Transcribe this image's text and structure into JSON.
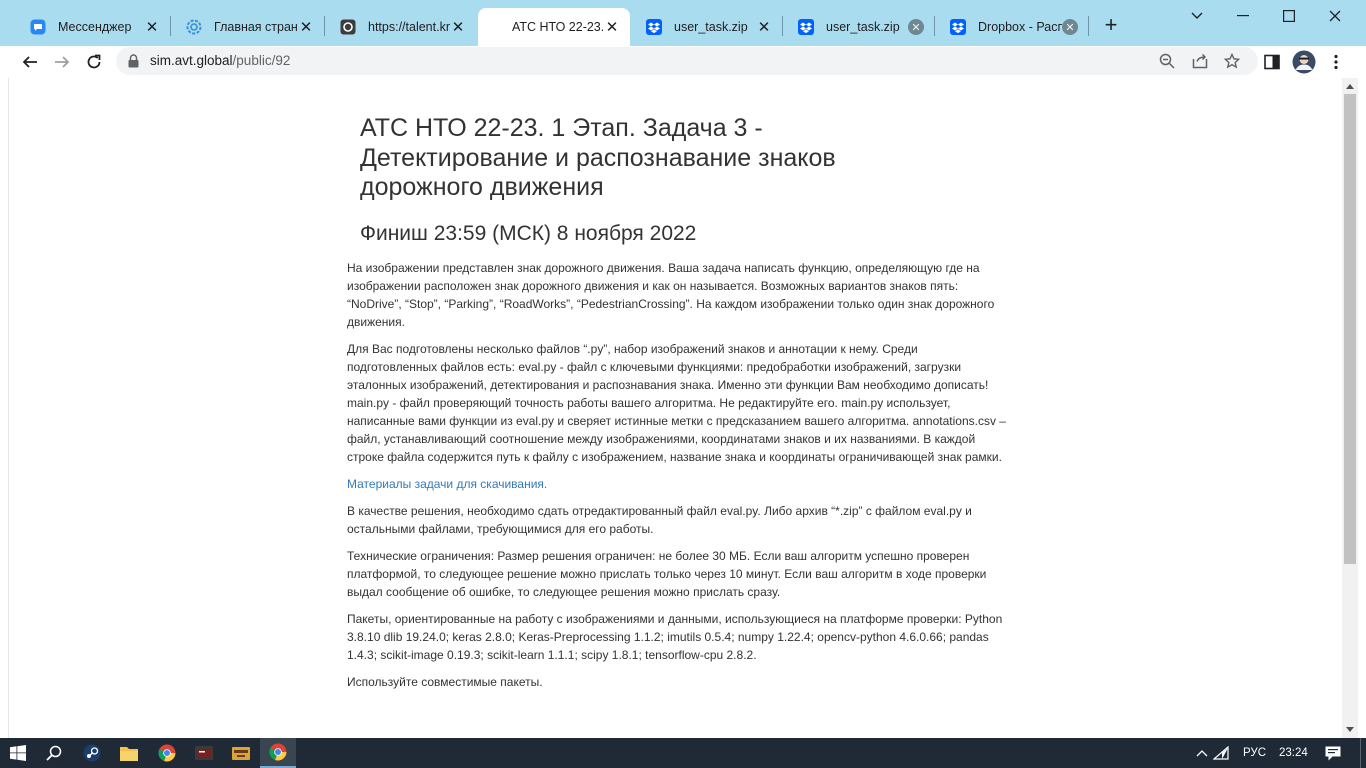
{
  "browser": {
    "tabs": [
      {
        "title": "Мессенджер",
        "icon": "messenger-icon",
        "close": "✕"
      },
      {
        "title": "Главная страниц",
        "icon": "gear-icon",
        "close": "✕"
      },
      {
        "title": "https://talent.kru",
        "icon": "talent-icon",
        "close": "✕"
      },
      {
        "title": "АТС НТО 22-23.",
        "icon": "none",
        "close": "✕",
        "active": true
      },
      {
        "title": "user_task.zip",
        "icon": "dropbox-icon",
        "close": "✕"
      },
      {
        "title": "user_task.zip",
        "icon": "dropbox-icon",
        "close": "✕"
      },
      {
        "title": "Dropbox - Распа",
        "icon": "dropbox-icon",
        "close": "✕"
      }
    ],
    "new_tab": "+",
    "url_host": "sim.avt.global",
    "url_path": "/public/92"
  },
  "page": {
    "title": "АТС НТО 22-23. 1 Этап. Задача 3 - Детектирование и распознавание знаков дорожного движения",
    "subtitle": "Финиш 23:59 (МСК) 8 ноября 2022",
    "p1": "На изображении представлен знак дорожного движения. Ваша задача написать функцию, определяющую где на изображении расположен знак дорожного движения и как он называется. Возможных вариантов знаков пять: “NoDrive”, “Stop”, “Parking”, “RoadWorks”, “PedestrianCrossing”. На каждом изображении только один знак дорожного движения.",
    "p2": "Для Вас подготовлены несколько файлов “.py”, набор изображений знаков и аннотации к нему. Среди подготовленных файлов есть: eval.py - файл с ключевыми функциями: предобработки изображений, загрузки эталонных изображений, детектирования и распознавания знака. Именно эти функции Вам необходимо дописать! main.py - файл проверяющий точность работы вашего алгоритма. Не редактируйте его. main.py использует, написанные вами функции из eval.py и сверяет истинные метки с предсказанием вашего алгоритма. annotations.csv – файл, устанавливающий соотношение между изображениями, координатами знаков и их названиями. В каждой строке файла содержится путь к файлу с изображением, название знака и координаты ограничивающей знак рамки.",
    "materials_link": "Материалы задачи для скачивания.",
    "p3": "В качестве решения, необходимо сдать отредактированный файл eval.py. Либо архив “*.zip” с файлом eval.py и остальными файлами, требующимися для его работы.",
    "p4": "Технические ограничения: Размер решения ограничен: не более 30 МБ. Если ваш алгоритм успешно проверен платформой, то следующее решение можно прислать только через 10 минут. Если ваш алгоритм в ходе проверки выдал сообщение об ошибке, то следующее решения можно прислать сразу.",
    "p5": "Пакеты, ориентированные на работу с изображениями и данными, использующиеся на платформе проверки: Python 3.8.10 dlib 19.24.0; keras 2.8.0; Keras-Preprocessing 1.1.2; imutils 0.5.4; numpy 1.22.4; opencv-python 4.6.0.66; pandas 1.4.3; scikit-image 0.19.3; scikit-learn 1.1.1; scipy 1.8.1; tensorflow-cpu 2.8.2.",
    "p6": "Используйте совместимые пакеты."
  },
  "taskbar": {
    "language": "РУС",
    "clock": "23:24"
  },
  "colors": {
    "tabstrip": "#aadcef",
    "link": "#337ab7",
    "taskbar": "#1f2a36"
  }
}
